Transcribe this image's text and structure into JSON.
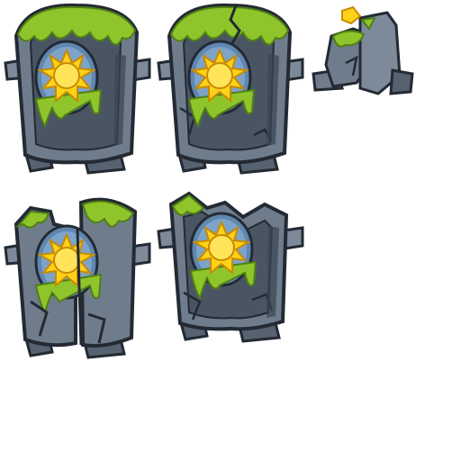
{
  "sheet": {
    "background": "#ffffff",
    "palette": {
      "stone_dark": "#3b4552",
      "stone_mid": "#6f7c8c",
      "stone_light": "#a7b3c2",
      "stone_edge": "#232a33",
      "moss": "#8fc52a",
      "moss_dark": "#4f7f16",
      "panel": "#5f87b0",
      "panel_light": "#8fb1d4",
      "sun": "#ffd21a",
      "sun_edge": "#c88a00"
    }
  },
  "sprites": [
    {
      "name": "tombstone-intact",
      "state": "intact"
    },
    {
      "name": "tombstone-cracked-top",
      "state": "cracked"
    },
    {
      "name": "tombstone-rubble",
      "state": "destroyed"
    },
    {
      "name": "tombstone-cracked-split",
      "state": "heavily-cracked"
    },
    {
      "name": "tombstone-broken-top",
      "state": "broken"
    }
  ]
}
